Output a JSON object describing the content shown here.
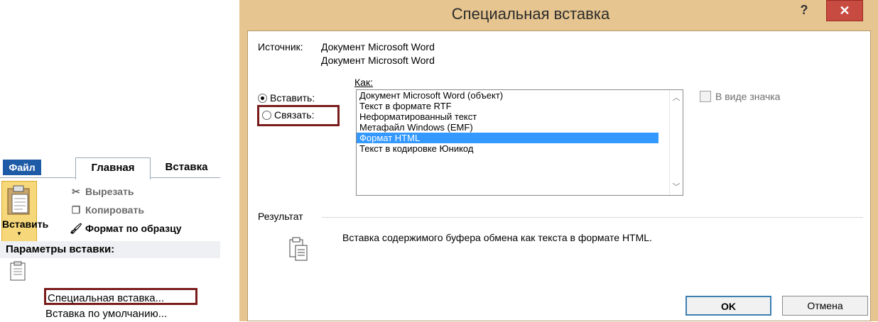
{
  "ribbon": {
    "tabs": {
      "file": "Файл",
      "home": "Главная",
      "insert": "Вставка"
    },
    "paste_button": {
      "label": "Вставить",
      "arrow": "▾"
    },
    "cut": "Вырезать",
    "copy": "Копировать",
    "format_painter": "Формат по образцу",
    "paste_params_title": "Параметры вставки:",
    "menu_special": "Специальная вставка...",
    "menu_default": "Вставка по умолчанию..."
  },
  "dialog": {
    "title": "Специальная вставка",
    "help": "?",
    "close": "✕",
    "source_label": "Источник:",
    "source_line1": "Документ Microsoft Word",
    "source_line2": "Документ Microsoft Word",
    "as_label": "Как:",
    "radio_paste": "Вставить:",
    "radio_link": "Связать:",
    "radio_selected": "paste",
    "list_items": [
      "Документ Microsoft Word (объект)",
      "Текст в формате RTF",
      "Неформатированный текст",
      "Метафайл Windows (EMF)",
      "Формат HTML",
      "Текст в кодировке Юникод"
    ],
    "list_selected_index": 4,
    "display_as_icon": "В виде значка",
    "display_as_icon_checked": false,
    "result_label": "Результат",
    "result_text": "Вставка содержимого буфера обмена как текста в формате HTML.",
    "ok": "OK",
    "cancel": "Отмена"
  },
  "colors": {
    "file_tab": "#1e5ba6",
    "dialog_frame": "#e6c590",
    "close_button": "#c84b42",
    "selection": "#3399ff",
    "highlight_box": "#7a1c1c"
  }
}
